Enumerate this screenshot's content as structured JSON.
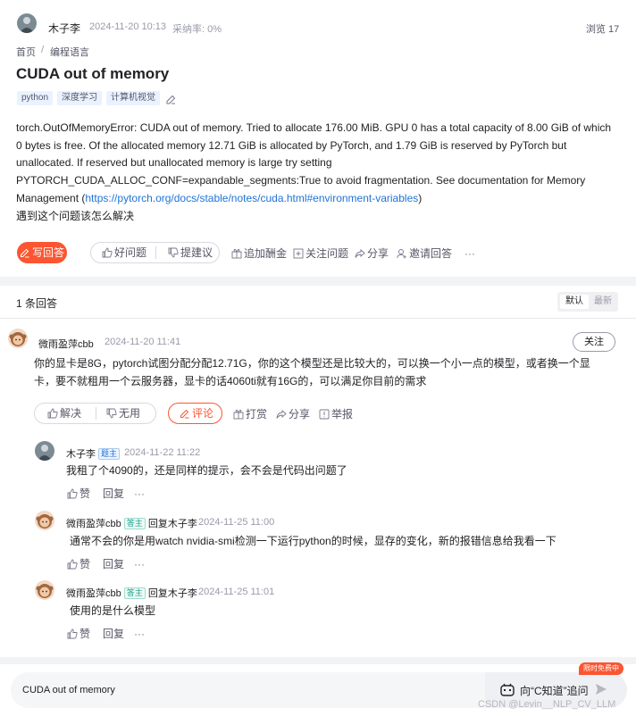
{
  "question": {
    "author": "木子李",
    "date": "2024-11-20 10:13",
    "adoption": "采纳率: 0%",
    "views": "浏览 17",
    "breadcrumb": [
      "首页",
      "/",
      "编程语言"
    ],
    "title": "CUDA out of memory",
    "tags": [
      "python",
      "深度学习",
      "计算机视觉"
    ],
    "body_lines": [
      "torch.OutOfMemoryError: CUDA out of memory. Tried to allocate 176.00 MiB. GPU 0 has a total capacity of 8.00 GiB of which",
      "0 bytes is free. Of the allocated memory 12.71 GiB is allocated by PyTorch, and 1.79 GiB is reserved by PyTorch but",
      "unallocated. If reserved but unallocated memory is large try setting",
      "PYTORCH_CUDA_ALLOC_CONF=expandable_segments:True to avoid fragmentation. See documentation for Memory"
    ],
    "body_line5_prefix": "Management (",
    "body_link": "https://pytorch.org/docs/stable/notes/cuda.html#environment-variables",
    "body_line5_suffix": ")",
    "body_question": "遇到这个问题该怎么解决",
    "actions": {
      "write_answer": "写回答",
      "good_question": "好问题",
      "suggest": "提建议",
      "bounty": "追加酬金",
      "follow": "关注问题",
      "share": "分享",
      "invite": "邀请回答",
      "more": "···"
    }
  },
  "answers_header": {
    "count": "1 条回答",
    "sort_default": "默认",
    "sort_latest": "最新"
  },
  "answer": {
    "author": "微雨盈萍cbb",
    "date": "2024-11-20 11:41",
    "follow": "关注",
    "text_line1": "你的显卡是8G，pytorch试图分配分配12.71G，你的这个模型还是比较大的，可以换一个小一点的模型，或者换一个显",
    "text_line2": "卡，要不就租用一个云服务器，显卡的话4060ti就有16G的，可以满足你目前的需求",
    "actions": {
      "solved": "解决",
      "useless": "无用",
      "comment": "评论",
      "tip": "打赏",
      "share": "分享",
      "report": "举报"
    }
  },
  "replies": [
    {
      "author": "木子李",
      "badge": "题主",
      "reply_to_prefix": "",
      "reply_to": "",
      "date": "2024-11-22 11:22",
      "text": "我租了个4090的，还是同样的提示，会不会是代码出问题了",
      "like": "赞",
      "reply": "回复",
      "more": "···"
    },
    {
      "author": "微雨盈萍cbb",
      "badge": "答主",
      "reply_to_prefix": "回复",
      "reply_to": "木子李",
      "date": "2024-11-25 11:00",
      "text": "通常不会的你是用watch nvidia-smi检测一下运行python的时候，显存的变化，新的报错信息给我看一下",
      "like": "赞",
      "reply": "回复",
      "more": "···"
    },
    {
      "author": "微雨盈萍cbb",
      "badge": "答主",
      "reply_to_prefix": "回复",
      "reply_to": "木子李",
      "date": "2024-11-25 11:01",
      "text": "使用的是什么模型",
      "like": "赞",
      "reply": "回复",
      "more": "···"
    }
  ],
  "bottom": {
    "input_value": "CUDA out of memory",
    "ask_label": "向“C知道”追问",
    "promo": "限时免费中",
    "watermark": "CSDN @Levin__NLP_CV_LLM"
  },
  "colors": {
    "accent": "#fc5531",
    "link": "#1f74d6",
    "muted": "#999aaa"
  }
}
